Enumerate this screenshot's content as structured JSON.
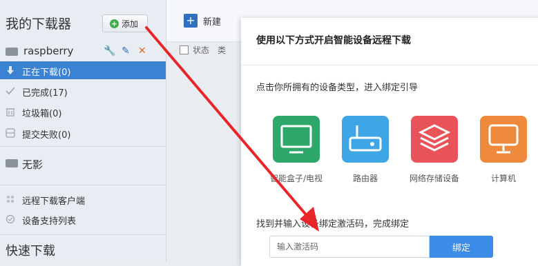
{
  "sidebar": {
    "title": "我的下载器",
    "add_label": "添加",
    "device": {
      "name": "raspberry"
    },
    "items": [
      {
        "label": "正在下载(0)"
      },
      {
        "label": "已完成(17)"
      },
      {
        "label": "垃圾箱(0)"
      },
      {
        "label": "提交失败(0)"
      }
    ],
    "other_device": "无影",
    "links": [
      {
        "label": "远程下载客户端"
      },
      {
        "label": "设备支持列表"
      }
    ],
    "quick_download": "快速下载"
  },
  "toolbar": {
    "new_label": "新建"
  },
  "list_header": {
    "status": "状态",
    "col2": "类"
  },
  "dialog": {
    "title": "使用以下方式开启智能设备远程下载",
    "subtitle": "点击你所拥有的设备类型，进入绑定引导",
    "devices": [
      {
        "label": "智能盒子/电视",
        "color": "#2ea86a",
        "icon": "tv-icon"
      },
      {
        "label": "路由器",
        "color": "#3fa6e6",
        "icon": "router-icon"
      },
      {
        "label": "网络存储设备",
        "color": "#e8545a",
        "icon": "nas-icon"
      },
      {
        "label": "计算机",
        "color": "#ef8a3c",
        "icon": "computer-icon"
      }
    ],
    "find_text": "找到并输入设备绑定激活码，完成绑定",
    "input_placeholder": "输入激活码",
    "bind_label": "绑定"
  },
  "colors": {
    "accent": "#3c82d3",
    "arrow": "#e8262a"
  }
}
